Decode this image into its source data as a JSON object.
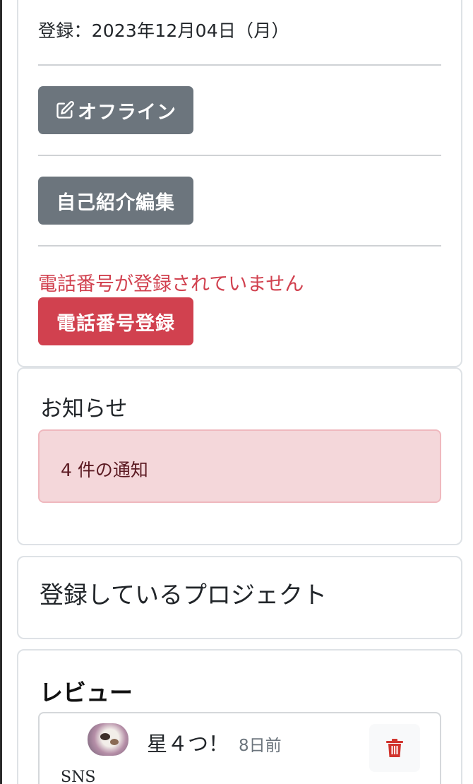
{
  "profile": {
    "registered_label": "登録：2023年12月04日（月）",
    "offline_button": "オフライン",
    "edit_intro_button": "自己紹介編集",
    "phone_warning": "電話番号が登録されていません",
    "phone_register_button": "電話番号登録"
  },
  "news": {
    "title": "お知らせ",
    "alert_text": "4 件の通知"
  },
  "projects": {
    "title": "登録しているプロジェクト"
  },
  "reviews": {
    "title": "レビュー",
    "items": [
      {
        "rating": "星４つ！",
        "ago": "8日前",
        "body": "SNS"
      }
    ]
  },
  "colors": {
    "secondary": "#6c757d",
    "danger": "#d1414f",
    "alert_bg": "#f4d7da"
  },
  "icons": {
    "offline_button": "pencil-square-icon",
    "delete_button": "trash-icon"
  }
}
